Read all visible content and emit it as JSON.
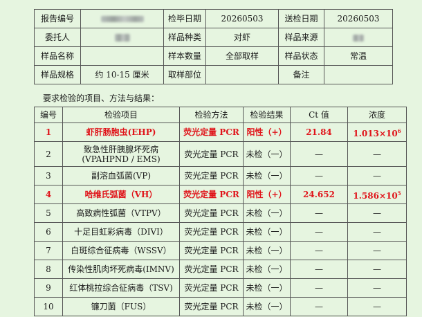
{
  "info": {
    "report_no_label": "报告编号",
    "check_date_label": "检毕日期",
    "check_date": "20260503",
    "submit_date_label": "送检日期",
    "submit_date": "20260503",
    "client_label": "委托人",
    "sample_type_label": "样品种类",
    "sample_type": "对虾",
    "sample_source_label": "样品来源",
    "sample_name_label": "样品名称",
    "sample_qty_label": "样本数量",
    "sample_qty": "全部取样",
    "sample_state_label": "样品状态",
    "sample_state": "常温",
    "sample_spec_label": "样品规格",
    "sample_spec": "约 10-15 厘米",
    "sampling_part_label": "取样部位",
    "remark_label": "备注"
  },
  "section_label": "要求检验的项目、方法与结果：",
  "headers": [
    "编号",
    "检验项目",
    "检验方法",
    "检验结果",
    "Ct 值",
    "浓度"
  ],
  "rows": [
    {
      "no": "1",
      "item": "虾肝肠胞虫(EHP)",
      "item2": "",
      "method": "荧光定量 PCR",
      "result": "阳性（+）",
      "ct": "21.84",
      "conc": "1.013×10",
      "exp": "6",
      "positive": true
    },
    {
      "no": "2",
      "item": "致急性肝胰腺坏死病",
      "item2": "(VPAHPND / EMS)",
      "method": "荧光定量 PCR",
      "result": "未检（一）",
      "ct": "—",
      "conc": "—",
      "exp": "",
      "positive": false
    },
    {
      "no": "3",
      "item": "副溶血弧菌(VP)",
      "item2": "",
      "method": "荧光定量 PCR",
      "result": "未检（一）",
      "ct": "—",
      "conc": "—",
      "exp": "",
      "positive": false
    },
    {
      "no": "4",
      "item": "哈维氏弧菌（VH）",
      "item2": "",
      "method": "荧光定量 PCR",
      "result": "阳性（+）",
      "ct": "24.652",
      "conc": "1.586×10",
      "exp": "5",
      "positive": true
    },
    {
      "no": "5",
      "item": "高致病性弧菌（VTPV）",
      "item2": "",
      "method": "荧光定量 PCR",
      "result": "未检（一）",
      "ct": "—",
      "conc": "—",
      "exp": "",
      "positive": false
    },
    {
      "no": "6",
      "item": "十足目虹彩病毒（DIVI）",
      "item2": "",
      "method": "荧光定量 PCR",
      "result": "未检（一）",
      "ct": "—",
      "conc": "—",
      "exp": "",
      "positive": false
    },
    {
      "no": "7",
      "item": "白斑综合征病毒（WSSV）",
      "item2": "",
      "method": "荧光定量 PCR",
      "result": "未检（一）",
      "ct": "—",
      "conc": "—",
      "exp": "",
      "positive": false
    },
    {
      "no": "8",
      "item": "传染性肌肉坏死病毒(IMNV)",
      "item2": "",
      "method": "荧光定量 PCR",
      "result": "未检（一）",
      "ct": "—",
      "conc": "—",
      "exp": "",
      "positive": false
    },
    {
      "no": "9",
      "item": "红体桃拉综合征病毒（TSV)",
      "item2": "",
      "method": "荧光定量 PCR",
      "result": "未检（一）",
      "ct": "—",
      "conc": "—",
      "exp": "",
      "positive": false
    },
    {
      "no": "10",
      "item": "镰刀菌（FUS）",
      "item2": "",
      "method": "荧光定量 PCR",
      "result": "未检（一）",
      "ct": "—",
      "conc": "—",
      "exp": "",
      "positive": false
    }
  ]
}
